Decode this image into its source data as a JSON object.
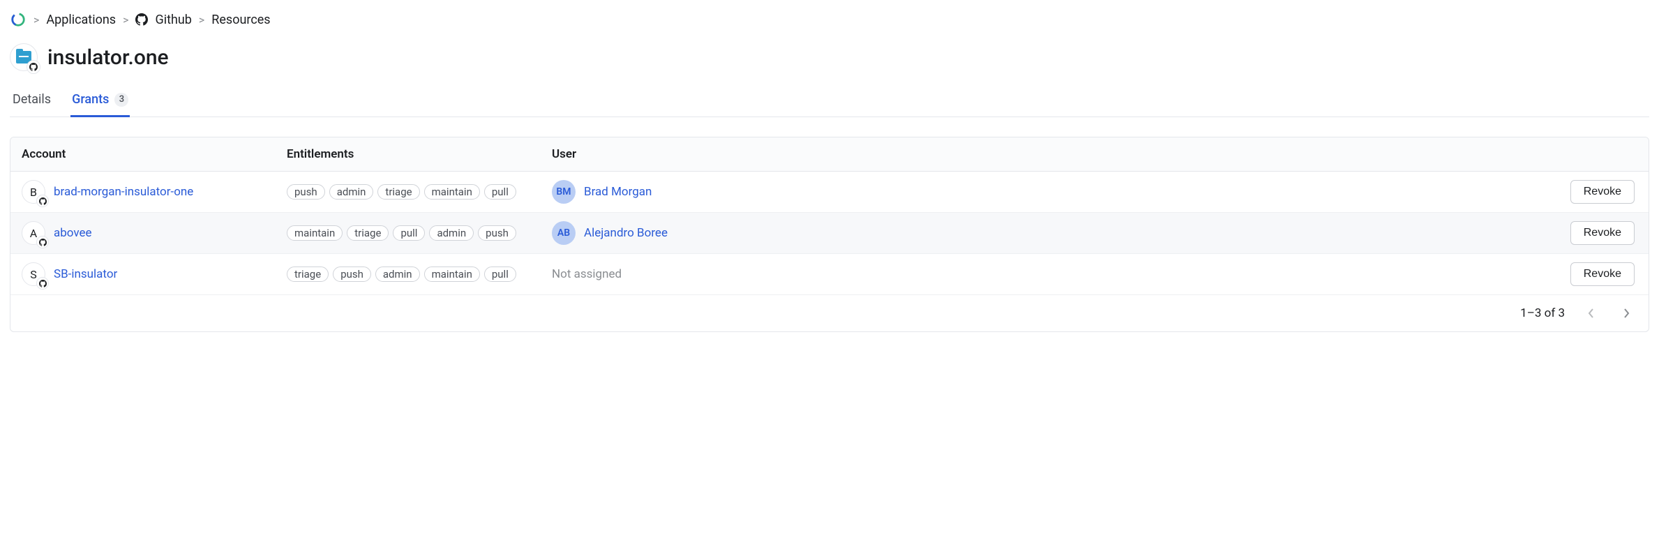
{
  "breadcrumb": {
    "items": [
      {
        "label": "Applications"
      },
      {
        "label": "Github"
      },
      {
        "label": "Resources"
      }
    ]
  },
  "page": {
    "title": "insulator.one"
  },
  "tabs": {
    "details": {
      "label": "Details"
    },
    "grants": {
      "label": "Grants",
      "count": "3"
    }
  },
  "table": {
    "headers": {
      "account": "Account",
      "entitlements": "Entitlements",
      "user": "User"
    },
    "rows": [
      {
        "account_initial": "B",
        "account_name": "brad-morgan-insulator-one",
        "entitlements": [
          "push",
          "admin",
          "triage",
          "maintain",
          "pull"
        ],
        "user": {
          "initials": "BM",
          "name": "Brad Morgan",
          "assigned": true
        },
        "action": "Revoke",
        "highlight": false
      },
      {
        "account_initial": "A",
        "account_name": "abovee",
        "entitlements": [
          "maintain",
          "triage",
          "pull",
          "admin",
          "push"
        ],
        "user": {
          "initials": "AB",
          "name": "Alejandro Boree",
          "assigned": true
        },
        "action": "Revoke",
        "highlight": true
      },
      {
        "account_initial": "S",
        "account_name": "SB-insulator",
        "entitlements": [
          "triage",
          "push",
          "admin",
          "maintain",
          "pull"
        ],
        "user": {
          "name": "Not assigned",
          "assigned": false
        },
        "action": "Revoke",
        "highlight": false
      }
    ],
    "pagination": {
      "label": "1–3 of 3"
    }
  }
}
